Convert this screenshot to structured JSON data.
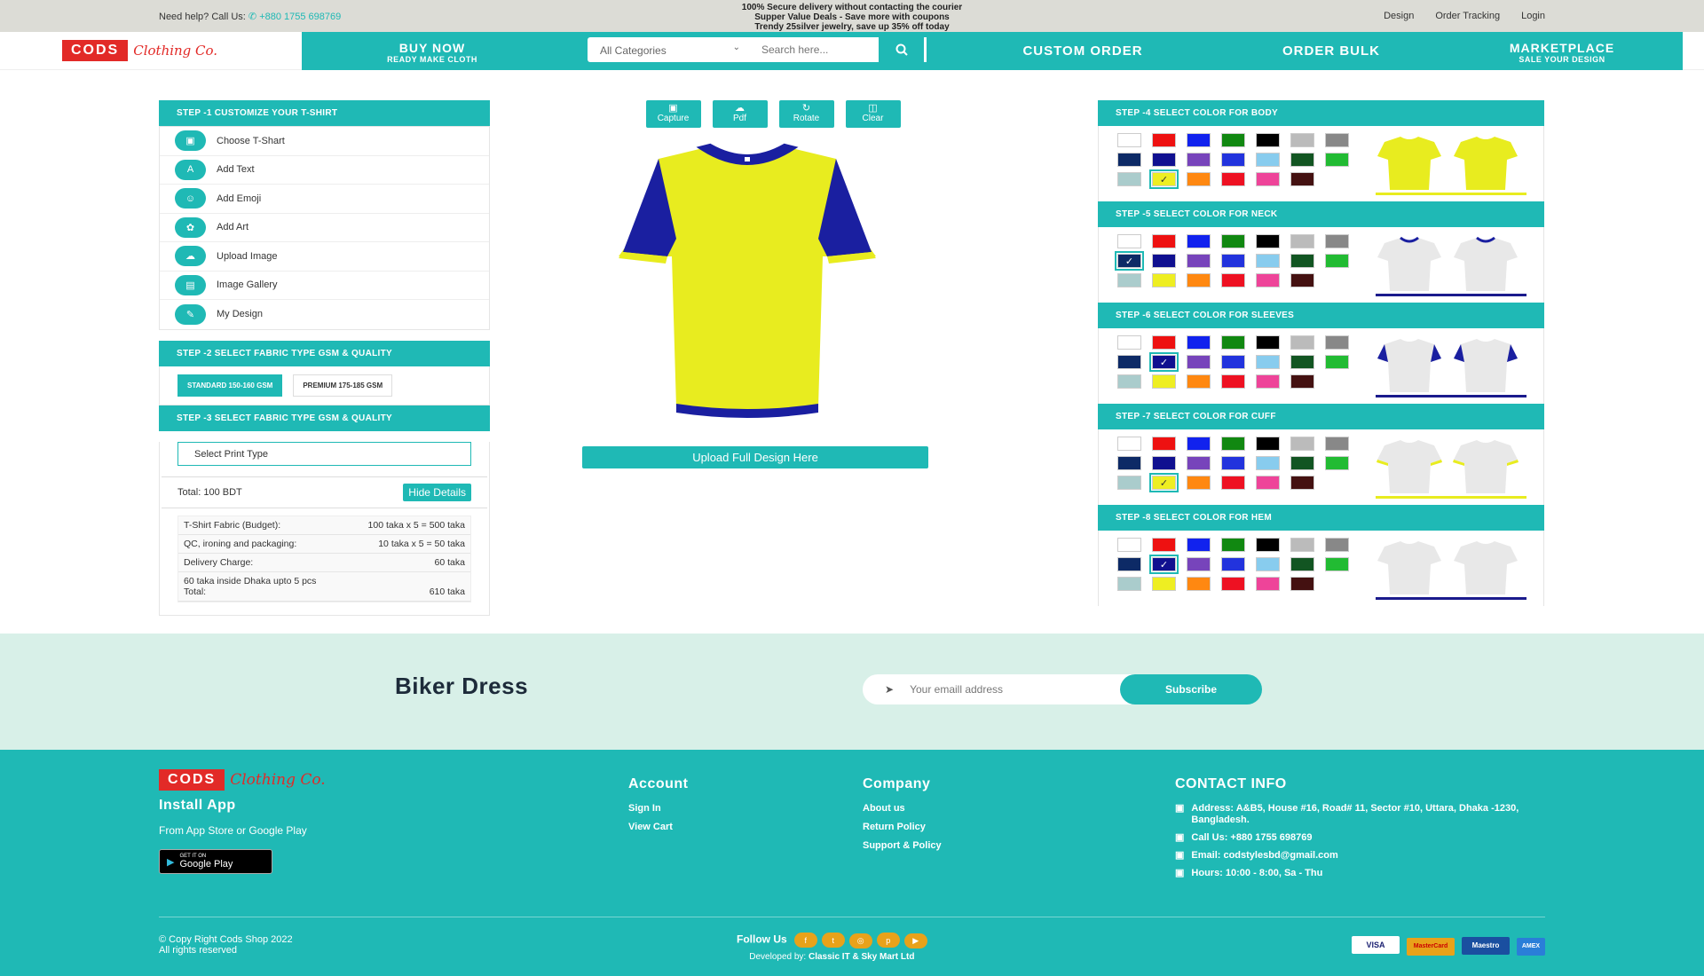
{
  "topbar": {
    "help": "Need help? Call Us:",
    "phone": "+880 1755 698769",
    "promo": [
      "100% Secure delivery without contacting the courier",
      "Supper Value Deals - Save more with coupons",
      "Trendy 25silver jewelry, save up 35% off today"
    ],
    "links": [
      "Design",
      "Order Tracking",
      "Login"
    ]
  },
  "logo": {
    "brand": "CODS",
    "script": "Clothing Co."
  },
  "nav": {
    "buy_now": "BUY NOW",
    "buy_now_sub": "READY MAKE CLOTH",
    "category": "All Categories",
    "search_placeholder": "Search here...",
    "custom_order": "CUSTOM ORDER",
    "order_bulk": "ORDER BULK",
    "marketplace": "MARKETPLACE",
    "marketplace_sub": "SALE YOUR DESIGN"
  },
  "step1": {
    "title": "STEP -1 CUSTOMIZE YOUR T-SHIRT",
    "options": [
      "Choose T-Shart",
      "Add Text",
      "Add Emoji",
      "Add Art",
      "Upload Image",
      "Image Gallery",
      "My Design"
    ]
  },
  "step2": {
    "title": "STEP -2 SELECT FABRIC TYPE GSM & QUALITY",
    "standard": "STANDARD 150-160 GSM",
    "premium": "PREMIUM 175-185 GSM"
  },
  "step3": {
    "title": "STEP -3 SELECT FABRIC TYPE GSM & QUALITY",
    "print_type": "Select Print Type",
    "total": "Total: 100 BDT",
    "hide_details": "Hide Details",
    "details": [
      {
        "label": "T-Shirt Fabric (Budget):",
        "value": "100 taka x 5 = 500 taka"
      },
      {
        "label": "QC, ironing and packaging:",
        "value": "10 taka x 5 = 50 taka"
      },
      {
        "label": "Delivery Charge:",
        "value": "60 taka"
      }
    ],
    "note": "60 taka inside Dhaka upto 5 pcs",
    "grand_label": "Total:",
    "grand_value": "610 taka"
  },
  "tools": [
    "Capture",
    "Pdf",
    "Rotate",
    "Clear"
  ],
  "upload": "Upload Full Design Here",
  "colors": [
    "#ffffff",
    "#ee1111",
    "#1122ee",
    "#118811",
    "#000000",
    "#bbbbbb",
    "#888888",
    "#0d2a66",
    "#101090",
    "#7744bb",
    "#2233dd",
    "#88ccee",
    "#125522",
    "#22bb33",
    "#aacccc",
    "#eeee22",
    "#ff8811",
    "#ee1122",
    "#ee4499",
    "#441111"
  ],
  "shirt_colors": {
    "body": "#e8ec1f",
    "neck": "#1a1fa0",
    "sleeves": "#1a1fa0",
    "cuff": "#e8ec1f",
    "hem": "#1a1fa0"
  },
  "steps_right": [
    {
      "title": "STEP -4 SELECT COLOR FOR BODY",
      "selected": 15
    },
    {
      "title": "STEP -5 SELECT COLOR FOR NECK",
      "selected": 7
    },
    {
      "title": "STEP -6 SELECT COLOR FOR SLEEVES",
      "selected": 8
    },
    {
      "title": "STEP -7 SELECT COLOR FOR CUFF",
      "selected": 15
    },
    {
      "title": "STEP -8 SELECT COLOR FOR HEM",
      "selected": 8
    }
  ],
  "newsletter": {
    "title": "Biker Dress",
    "placeholder": "Your emaill address",
    "button": "Subscribe"
  },
  "footer": {
    "install": "Install App",
    "install_sub": "From App Store or Google Play",
    "gplay_small": "GET IT ON",
    "gplay": "Google Play",
    "account_title": "Account",
    "account_links": [
      "Sign In",
      "View Cart"
    ],
    "company_title": "Company",
    "company_links": [
      "About us",
      "Return Policy",
      "Support & Policy"
    ],
    "contact_title": "CONTACT INFO",
    "address": "Address: A&B5, House #16, Road# 11, Sector #10, Uttara, Dhaka -1230, Bangladesh.",
    "phone": "Call Us: +880 1755 698769",
    "email": "Email: codstylesbd@gmail.com",
    "hours": "Hours: 10:00 - 8:00, Sa - Thu",
    "copyright": "© Copy Right Cods Shop  2022",
    "rights": "All rights reserved",
    "follow": "Follow Us",
    "developed_prefix": "Developed by:",
    "developed": "Classic IT & Sky Mart Ltd",
    "payments": [
      "VISA",
      "MasterCard",
      "Maestro",
      "AMEX"
    ]
  }
}
